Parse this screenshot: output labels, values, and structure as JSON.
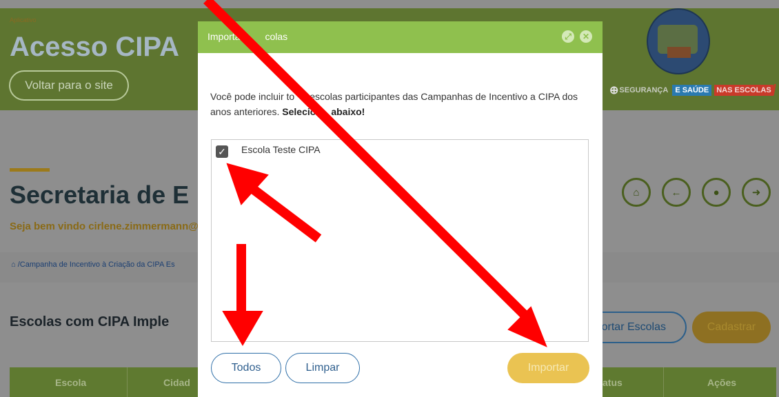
{
  "header": {
    "tiny_tag": "Aplicativo",
    "app_title": "Acesso CIPA",
    "back_label": "Voltar para o site",
    "logo_seg1": "SEGURANÇA",
    "logo_seg2": "E SAÚDE",
    "logo_seg3": "NAS ESCOLAS"
  },
  "page": {
    "title": "Secretaria de E",
    "welcome": "Seja bem vindo cirlene.zimmermann@",
    "breadcrumb": "/Campanha de Incentivo à Criação da CIPA Es",
    "section_title": "Escolas com CIPA Imple",
    "import_label": "Importar Escolas",
    "import_label_visible": "ortar Escolas",
    "cadastrar_label": "Cadastrar"
  },
  "table": {
    "headers": [
      "Escola",
      "Cidade",
      "Status",
      "Ações"
    ],
    "header_visible": [
      "Escola",
      "Cidad",
      "atus",
      "Ações"
    ]
  },
  "modal": {
    "title": "Importar Escolas",
    "title_visible": "Importa",
    "title_visible_2": "colas",
    "text_part1": "Você pode incluir to",
    "text_part2": "escolas participantes das Campanhas de Incentivo a CIPA dos",
    "text_line2": "anos anteriores. ",
    "text_bold_a": "Selecio",
    "text_bold_b": "abaixo!",
    "items": [
      {
        "label": "Escola Teste CIPA",
        "checked": true
      }
    ],
    "todos_label": "Todos",
    "limpar_label": "Limpar",
    "importar_label": "Importar"
  },
  "colors": {
    "modal_header": "#8fc04e",
    "importar_button": "#eac352",
    "annotation_arrows": "#ff0000"
  }
}
